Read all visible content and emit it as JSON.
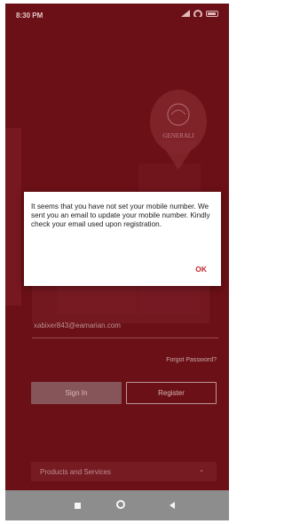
{
  "status_bar": {
    "time": "8:30 PM"
  },
  "brand": {
    "logo_text": "GENERALI"
  },
  "login": {
    "email_value": "xabixer843@eamarian.com",
    "forgot_password": "Forgot Password?",
    "sign_in": "Sign In",
    "register": "Register",
    "products_services": "Products and Services"
  },
  "dialog": {
    "message": "It seems that you have not set your mobile number. We sent you an email to update your mobile number. Kindly check your email used upon registration.",
    "ok_label": "OK"
  },
  "colors": {
    "background": "#6e1218",
    "accent": "#c0282f",
    "nav_bar": "#8d8d8d"
  },
  "icons": [
    "signal-icon",
    "wifi-icon",
    "battery-icon",
    "chevron-down-icon",
    "nav-recents-icon",
    "nav-home-icon",
    "nav-back-icon"
  ]
}
